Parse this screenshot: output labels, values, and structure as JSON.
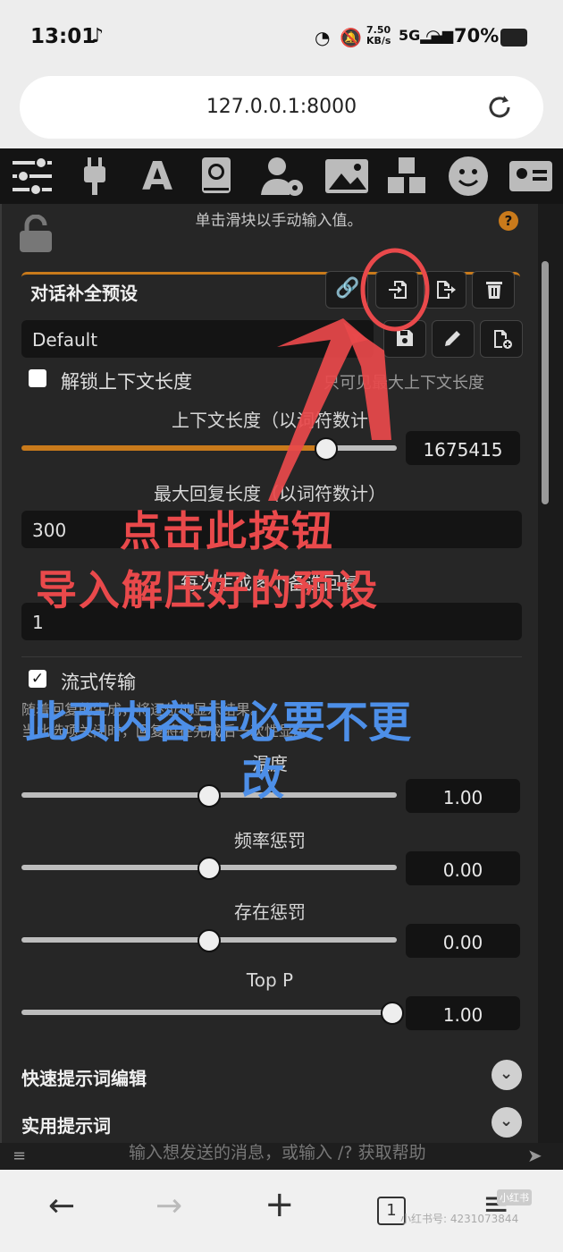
{
  "status": {
    "time": "13:01",
    "net_speed": "7.50",
    "net_unit": "KB/s",
    "battery": "70%"
  },
  "browser": {
    "url": "127.0.0.1:8000"
  },
  "panel": {
    "hint": "单击滑块以手动输入值。",
    "help_icon": "?",
    "preset_title": "对话补全预设",
    "preset_value": "Default",
    "unlock_context_label": "解锁上下文长度",
    "unlock_context_note": "只可见最大上下文长度",
    "context_label": "上下文长度（以词符数计",
    "context_value": "1675415",
    "context_fraction": 0.82,
    "max_reply_label": "最大回复长度（以词符数计）",
    "max_reply_value": "300",
    "multi_gen_label": "每次生成多个备选回复",
    "multi_gen_value": "1",
    "streaming_label": "流式传输",
    "streaming_desc1": "随着回复的生成，将逐位地显示结果。",
    "streaming_desc2": "当此选项关闭时，回复将在完成后一次性显示。",
    "temp_label": "温度",
    "temp_value": "1.00",
    "temp_fraction": 0.5,
    "freq_label": "频率惩罚",
    "freq_value": "0.00",
    "freq_fraction": 0.5,
    "presence_label": "存在惩罚",
    "presence_value": "0.00",
    "presence_fraction": 0.5,
    "topp_label": "Top P",
    "topp_value": "1.00",
    "topp_fraction": 1.0,
    "quick_prompt": "快速提示词编辑",
    "utility_prompt": "实用提示词",
    "input_placeholder": "输入想发送的消息，或输入 /? 获取帮助"
  },
  "overlay": {
    "red_line1": "点击此按钮",
    "red_line2": "导入解压好的预设",
    "blue_line1": "此页内容非必要不更",
    "blue_line2": "改"
  },
  "watermark": {
    "brand": "小红书",
    "id": "小红书号: 4231073844"
  },
  "colors": {
    "accent_orange": "#c97a1b",
    "link_green": "#4caf50",
    "annotation_red": "#e9494b",
    "annotation_blue": "#4d8fe8"
  }
}
